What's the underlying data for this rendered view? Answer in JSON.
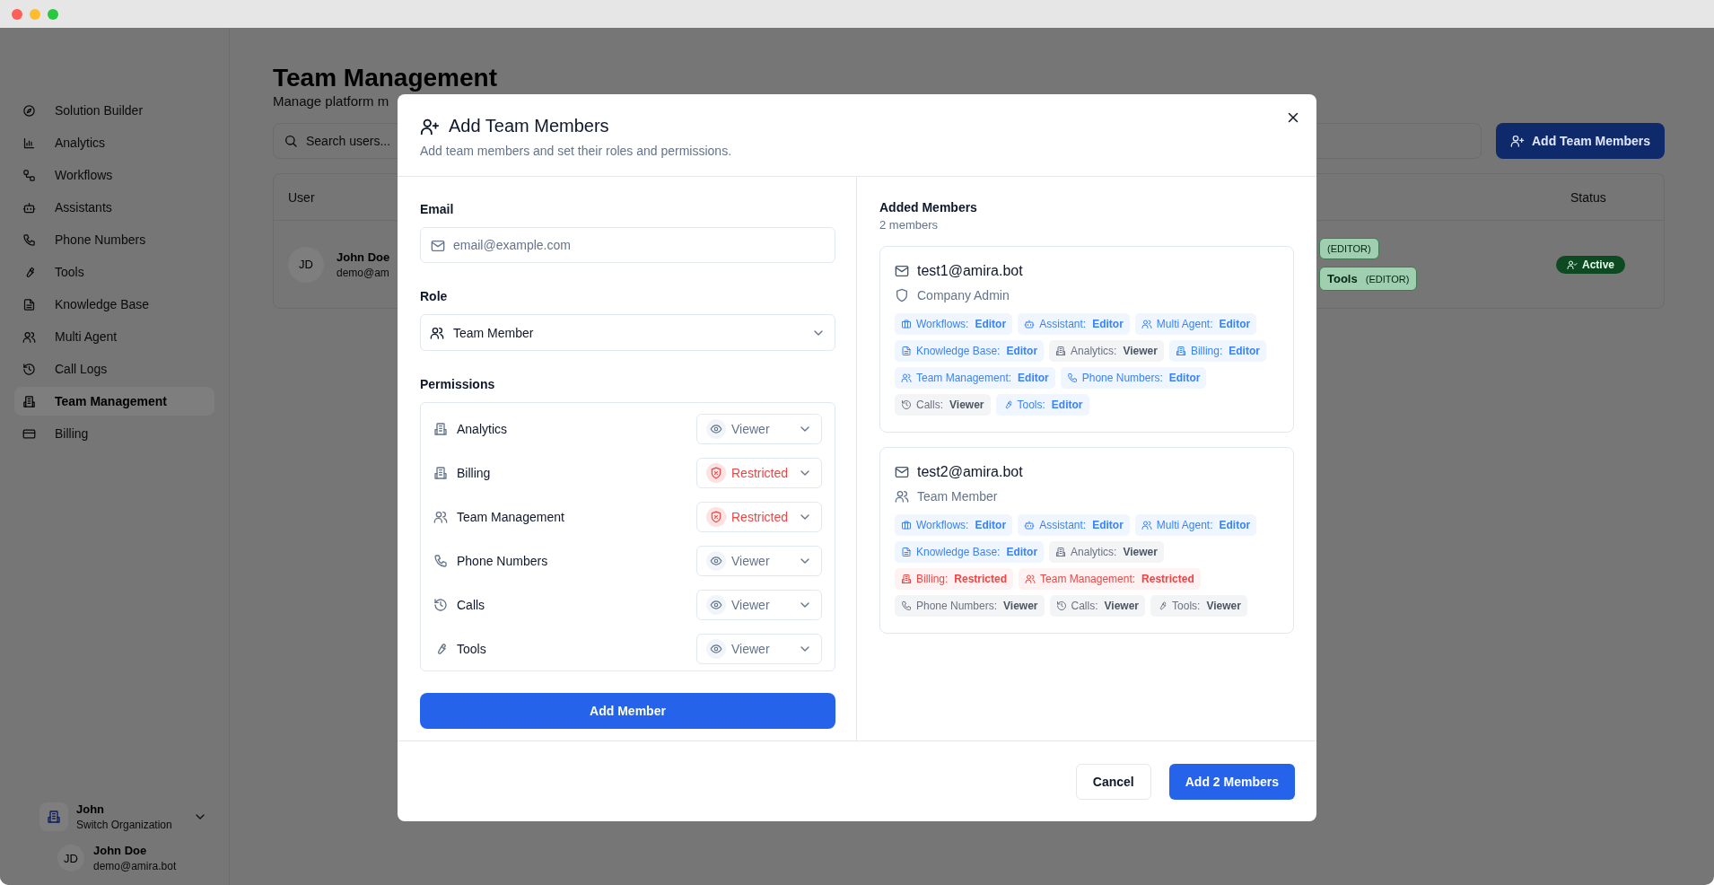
{
  "sidebar": {
    "items": [
      {
        "label": "Solution Builder",
        "selected": false
      },
      {
        "label": "Analytics",
        "selected": false
      },
      {
        "label": "Workflows",
        "selected": false
      },
      {
        "label": "Assistants",
        "selected": false
      },
      {
        "label": "Phone Numbers",
        "selected": false
      },
      {
        "label": "Tools",
        "selected": false
      },
      {
        "label": "Knowledge Base",
        "selected": false
      },
      {
        "label": "Multi Agent",
        "selected": false
      },
      {
        "label": "Call Logs",
        "selected": false
      },
      {
        "label": "Team Management",
        "selected": true
      },
      {
        "label": "Billing",
        "selected": false
      }
    ],
    "organization": {
      "name": "John",
      "action": "Switch Organization"
    },
    "user": {
      "initials": "JD",
      "name": "John Doe",
      "email": "demo@amira.bot"
    }
  },
  "page": {
    "title": "Team Management",
    "subtitle": "Manage platform m",
    "search": {
      "placeholder": "Search users..."
    },
    "add_button": "Add Team Members",
    "table": {
      "columns": [
        "User",
        "Status"
      ],
      "rows": [
        {
          "initials": "JD",
          "name": "John Doe",
          "email": "demo@am",
          "permissions": [
            {
              "role": "(EDITOR)"
            },
            {
              "name": "Tools",
              "role": "(EDITOR)"
            }
          ],
          "status": "Active"
        }
      ]
    }
  },
  "dialog": {
    "title": "Add Team Members",
    "subtitle": "Add team members and set their roles and permissions.",
    "form": {
      "email_label": "Email",
      "email_placeholder": "email@example.com",
      "role_label": "Role",
      "role_value": "Team Member",
      "permissions_label": "Permissions",
      "permissions": [
        {
          "label": "Analytics",
          "access": "Viewer",
          "kind": "viewer"
        },
        {
          "label": "Billing",
          "access": "Restricted",
          "kind": "restricted"
        },
        {
          "label": "Team Management",
          "access": "Restricted",
          "kind": "restricted"
        },
        {
          "label": "Phone Numbers",
          "access": "Viewer",
          "kind": "viewer"
        },
        {
          "label": "Calls",
          "access": "Viewer",
          "kind": "viewer"
        },
        {
          "label": "Tools",
          "access": "Viewer",
          "kind": "viewer"
        }
      ],
      "add_member_button": "Add Member"
    },
    "added": {
      "title": "Added Members",
      "count": "2 members",
      "members": [
        {
          "email": "test1@amira.bot",
          "role": "Company Admin",
          "chips": [
            {
              "area": "Workflows:",
              "access": "Editor",
              "kind": "editor"
            },
            {
              "area": "Assistant:",
              "access": "Editor",
              "kind": "editor"
            },
            {
              "area": "Multi Agent:",
              "access": "Editor",
              "kind": "editor"
            },
            {
              "area": "Knowledge Base:",
              "access": "Editor",
              "kind": "editor"
            },
            {
              "area": "Analytics:",
              "access": "Viewer",
              "kind": "viewer"
            },
            {
              "area": "Billing:",
              "access": "Editor",
              "kind": "editor"
            },
            {
              "area": "Team Management:",
              "access": "Editor",
              "kind": "editor"
            },
            {
              "area": "Phone Numbers:",
              "access": "Editor",
              "kind": "editor"
            },
            {
              "area": "Calls:",
              "access": "Viewer",
              "kind": "viewer"
            },
            {
              "area": "Tools:",
              "access": "Editor",
              "kind": "editor"
            }
          ]
        },
        {
          "email": "test2@amira.bot",
          "role": "Team Member",
          "chips": [
            {
              "area": "Workflows:",
              "access": "Editor",
              "kind": "editor"
            },
            {
              "area": "Assistant:",
              "access": "Editor",
              "kind": "editor"
            },
            {
              "area": "Multi Agent:",
              "access": "Editor",
              "kind": "editor"
            },
            {
              "area": "Knowledge Base:",
              "access": "Editor",
              "kind": "editor"
            },
            {
              "area": "Analytics:",
              "access": "Viewer",
              "kind": "viewer"
            },
            {
              "area": "Billing:",
              "access": "Restricted",
              "kind": "restricted"
            },
            {
              "area": "Team Management:",
              "access": "Restricted",
              "kind": "restricted"
            },
            {
              "area": "Phone Numbers:",
              "access": "Viewer",
              "kind": "viewer"
            },
            {
              "area": "Calls:",
              "access": "Viewer",
              "kind": "viewer"
            },
            {
              "area": "Tools:",
              "access": "Viewer",
              "kind": "viewer"
            }
          ]
        }
      ]
    },
    "footer": {
      "cancel": "Cancel",
      "confirm": "Add 2 Members"
    }
  }
}
